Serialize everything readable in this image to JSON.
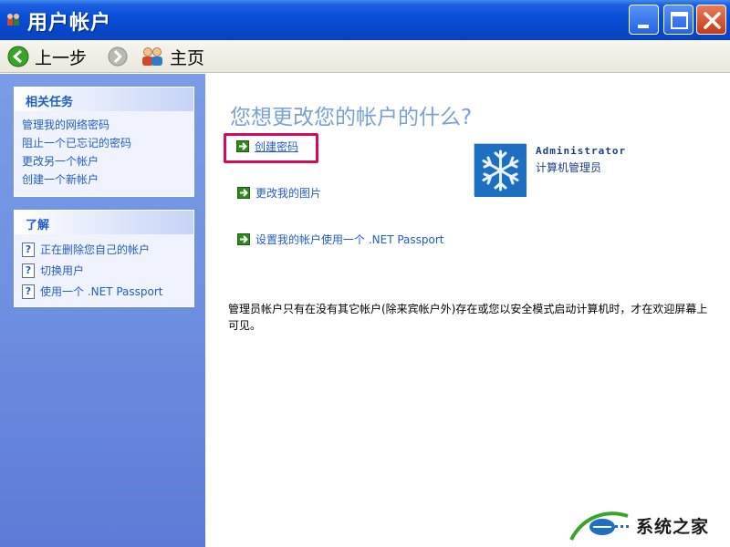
{
  "window": {
    "title": "用户帐户"
  },
  "toolbar": {
    "back_label": "上一步",
    "home_label": "主页"
  },
  "sidebar": {
    "related_tasks": {
      "header": "相关任务",
      "items": [
        "管理我的网络密码",
        "阻止一个已忘记的密码",
        "更改另一个帐户",
        "创建一个新帐户"
      ]
    },
    "learn": {
      "header": "了解",
      "items": [
        "正在删除您自己的帐户",
        "切换用户",
        "使用一个 .NET Passport"
      ]
    }
  },
  "main": {
    "title": "您想更改您的帐户的什么?",
    "actions": [
      "创建密码",
      "更改我的图片",
      "设置我的帐户使用一个 .NET Passport"
    ],
    "account": {
      "name": "Administrator",
      "role": "计算机管理员"
    },
    "note": "管理员帐户只有在没有其它帐户(除来宾帐户外)存在或您以安全模式启动计算机时，才在欢迎屏幕上可见。"
  },
  "watermark": {
    "text": "系统之家"
  },
  "colors": {
    "titlebar": "#0a4fd8",
    "sidebar": "#6e8ee0",
    "link": "#215dc6",
    "highlight": "#d40a5e"
  }
}
